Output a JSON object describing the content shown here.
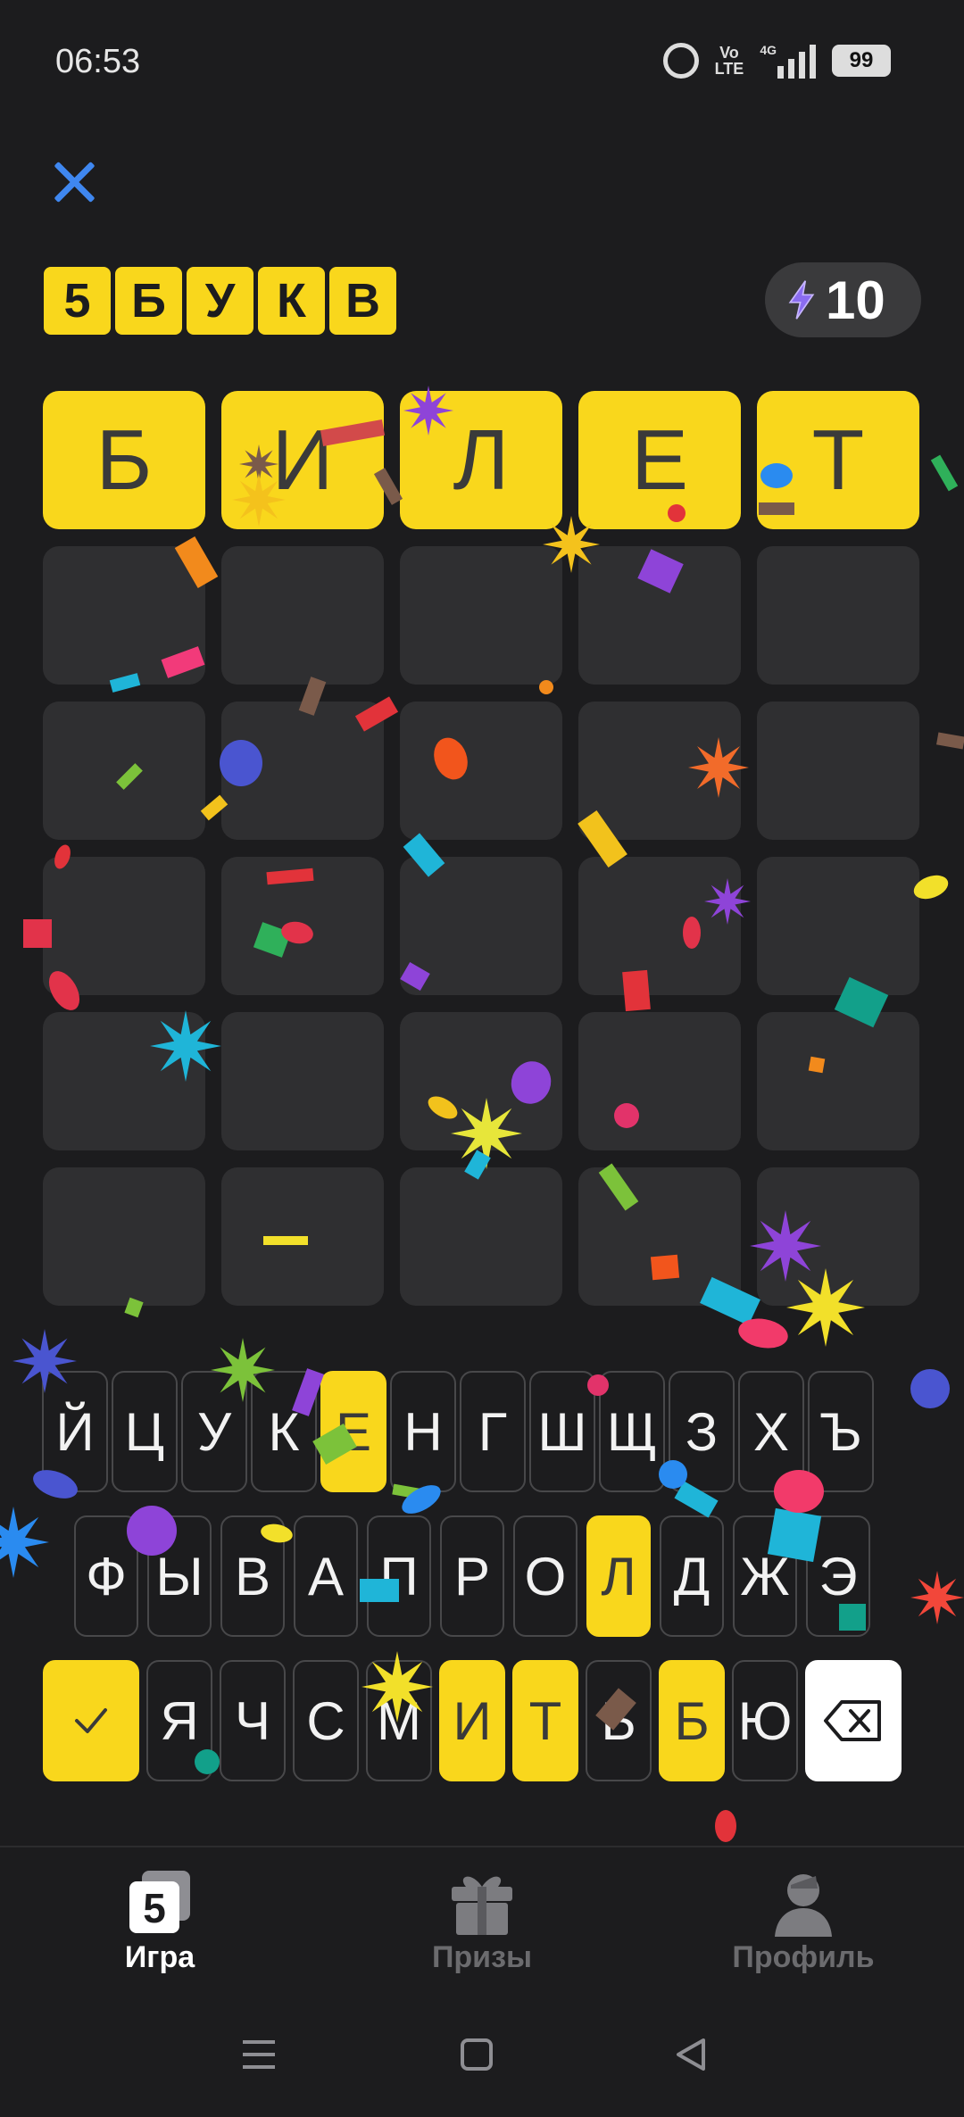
{
  "status_bar": {
    "time": "06:53",
    "network": "4G",
    "volte": "Vo\nLTE",
    "battery": "99"
  },
  "header": {
    "logo_letters": [
      "5",
      "Б",
      "У",
      "К",
      "В"
    ],
    "energy_value": "10"
  },
  "board": {
    "rows": [
      [
        {
          "letter": "Б",
          "state": "correct"
        },
        {
          "letter": "И",
          "state": "correct"
        },
        {
          "letter": "Л",
          "state": "correct"
        },
        {
          "letter": "Е",
          "state": "correct"
        },
        {
          "letter": "Т",
          "state": "correct"
        }
      ],
      [
        {
          "letter": "",
          "state": "empty"
        },
        {
          "letter": "",
          "state": "empty"
        },
        {
          "letter": "",
          "state": "empty"
        },
        {
          "letter": "",
          "state": "empty"
        },
        {
          "letter": "",
          "state": "empty"
        }
      ],
      [
        {
          "letter": "",
          "state": "empty"
        },
        {
          "letter": "",
          "state": "empty"
        },
        {
          "letter": "",
          "state": "empty"
        },
        {
          "letter": "",
          "state": "empty"
        },
        {
          "letter": "",
          "state": "empty"
        }
      ],
      [
        {
          "letter": "",
          "state": "empty"
        },
        {
          "letter": "",
          "state": "empty"
        },
        {
          "letter": "",
          "state": "empty"
        },
        {
          "letter": "",
          "state": "empty"
        },
        {
          "letter": "",
          "state": "empty"
        }
      ],
      [
        {
          "letter": "",
          "state": "empty"
        },
        {
          "letter": "",
          "state": "empty"
        },
        {
          "letter": "",
          "state": "empty"
        },
        {
          "letter": "",
          "state": "empty"
        },
        {
          "letter": "",
          "state": "empty"
        }
      ],
      [
        {
          "letter": "",
          "state": "empty"
        },
        {
          "letter": "",
          "state": "empty"
        },
        {
          "letter": "",
          "state": "empty"
        },
        {
          "letter": "",
          "state": "empty"
        },
        {
          "letter": "",
          "state": "empty"
        }
      ]
    ]
  },
  "keyboard": {
    "row1": [
      {
        "label": "Й",
        "state": "unused"
      },
      {
        "label": "Ц",
        "state": "unused"
      },
      {
        "label": "У",
        "state": "unused"
      },
      {
        "label": "К",
        "state": "unused"
      },
      {
        "label": "Е",
        "state": "hit"
      },
      {
        "label": "Н",
        "state": "unused"
      },
      {
        "label": "Г",
        "state": "unused"
      },
      {
        "label": "Ш",
        "state": "unused"
      },
      {
        "label": "Щ",
        "state": "unused"
      },
      {
        "label": "З",
        "state": "unused"
      },
      {
        "label": "Х",
        "state": "unused"
      },
      {
        "label": "Ъ",
        "state": "unused"
      }
    ],
    "row2": [
      {
        "label": "Ф",
        "state": "unused"
      },
      {
        "label": "Ы",
        "state": "unused"
      },
      {
        "label": "В",
        "state": "unused"
      },
      {
        "label": "А",
        "state": "unused"
      },
      {
        "label": "П",
        "state": "unused"
      },
      {
        "label": "Р",
        "state": "unused"
      },
      {
        "label": "О",
        "state": "unused"
      },
      {
        "label": "Л",
        "state": "hit"
      },
      {
        "label": "Д",
        "state": "unused"
      },
      {
        "label": "Ж",
        "state": "unused"
      },
      {
        "label": "Э",
        "state": "unused"
      }
    ],
    "row3": [
      {
        "label": "Я",
        "state": "unused"
      },
      {
        "label": "Ч",
        "state": "unused"
      },
      {
        "label": "С",
        "state": "unused"
      },
      {
        "label": "М",
        "state": "unused"
      },
      {
        "label": "И",
        "state": "hit"
      },
      {
        "label": "Т",
        "state": "hit"
      },
      {
        "label": "Ь",
        "state": "unused"
      },
      {
        "label": "Б",
        "state": "hit"
      },
      {
        "label": "Ю",
        "state": "unused"
      }
    ],
    "submit_icon": "checkmark-icon",
    "backspace_icon": "backspace-icon"
  },
  "bottom_nav": {
    "items": [
      {
        "label": "Игра",
        "icon": "game-icon",
        "active": true
      },
      {
        "label": "Призы",
        "icon": "gift-icon",
        "active": false
      },
      {
        "label": "Профиль",
        "icon": "profile-icon",
        "active": false
      }
    ]
  },
  "colors": {
    "correct": "#f9d71c",
    "background": "#1c1c1e",
    "tile_empty": "#2f2f31",
    "accent_blue": "#3f87f0",
    "energy_purple": "#8a6cf0"
  }
}
